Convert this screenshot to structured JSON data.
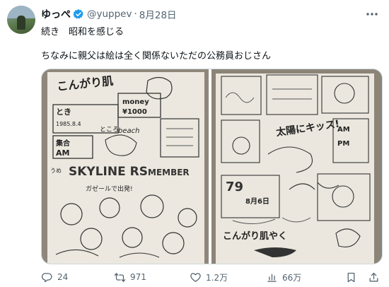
{
  "tweet": {
    "display_name": "ゆっぺ",
    "handle": "@yuppev",
    "separator": "·",
    "date": "8月28日",
    "text_line1": "続き　昭和を感じる",
    "text_line2": "ちなみに親父は絵は全く関係ないただの公務員おじさん"
  },
  "stats": {
    "replies": "24",
    "retweets": "971",
    "likes": "1.2万",
    "views": "66万"
  },
  "image_left": {
    "headline": "こんがり肌",
    "date_label": "とき",
    "date_value": "1985.8.4",
    "place_label": "ところ",
    "place_value": "beach",
    "money_label": "money",
    "money_value": "¥1000",
    "gather_label": "集合",
    "time_value": "AM",
    "team_prefix": "うめ",
    "team_name": "SKYLINE RS",
    "team_member": "MEMBER",
    "car_caption": "ガゼールで出発!"
  },
  "image_right": {
    "banner_text": "太陽にキッス!",
    "ending_text": "こんがり肌やく",
    "big_number": "79",
    "date_text": "8月6日",
    "am_label": "AM",
    "pm_label": "PM"
  },
  "colors": {
    "text": "#0f1419",
    "muted": "#536471",
    "verified": "#1d9bf0",
    "border": "#cfd9de"
  }
}
